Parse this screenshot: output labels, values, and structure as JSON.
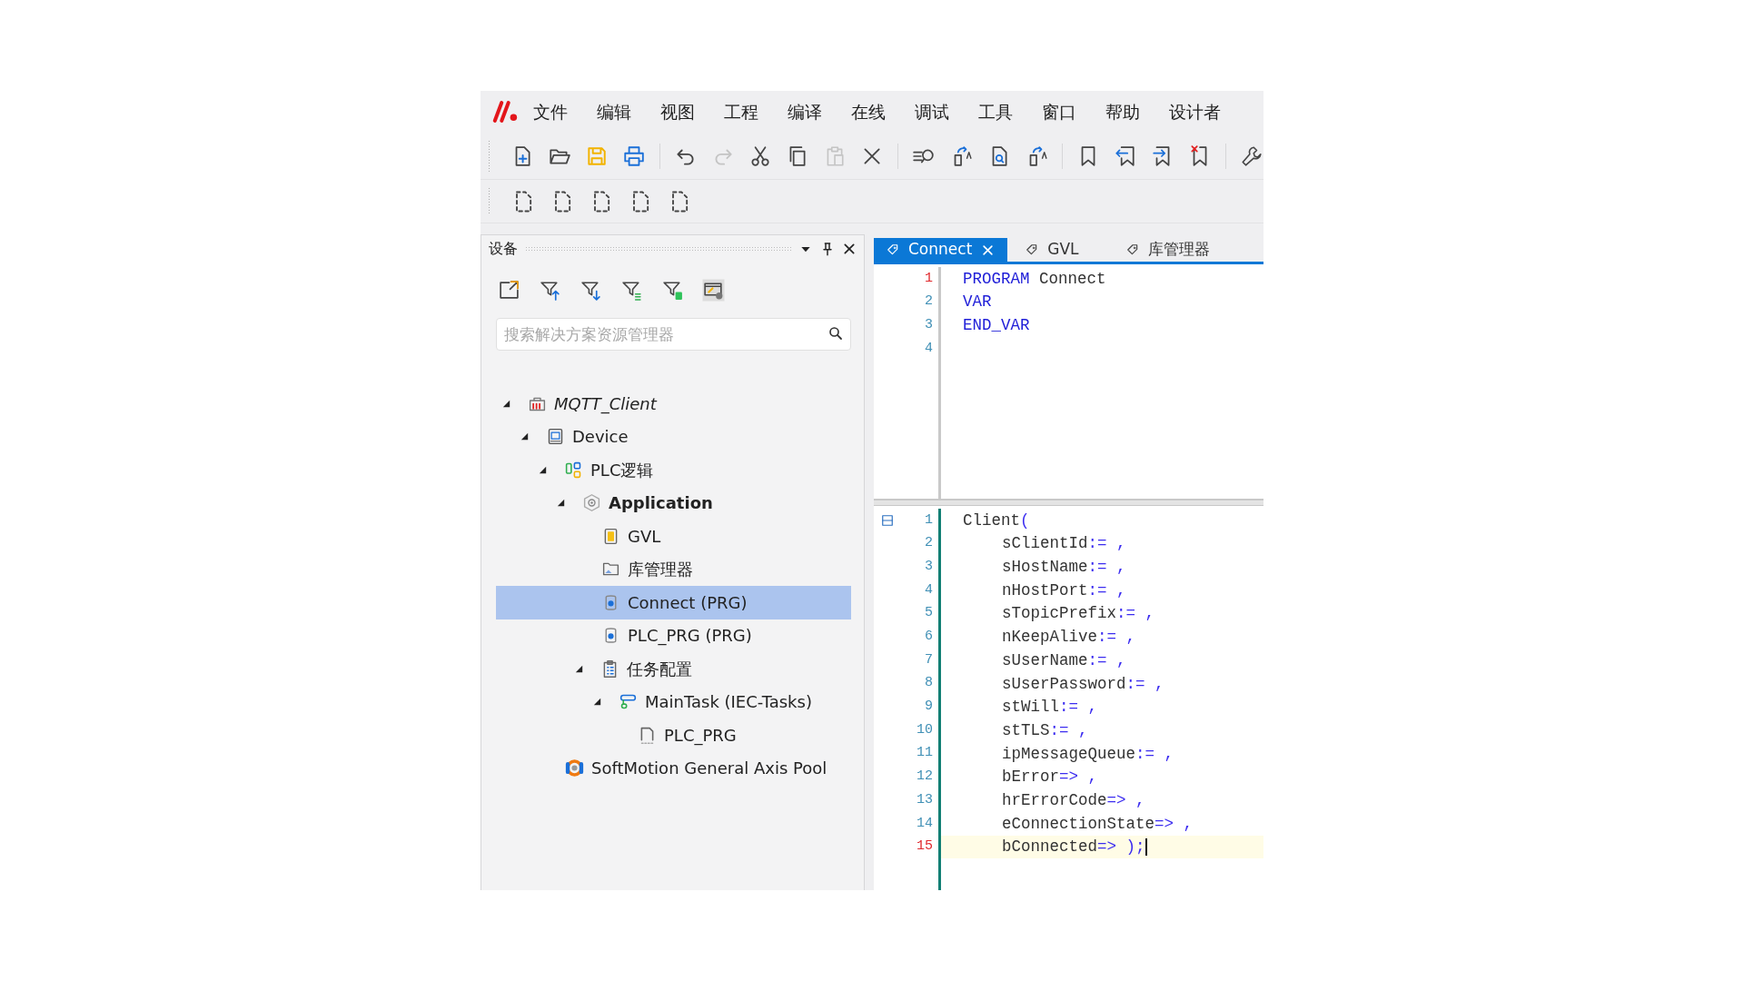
{
  "menu_bar": {
    "items": [
      "文件",
      "编辑",
      "视图",
      "工程",
      "编译",
      "在线",
      "调试",
      "工具",
      "窗口",
      "帮助",
      "设计者"
    ]
  },
  "toolbar_rows": [
    [
      {
        "kind": "new-file",
        "disabled": false
      },
      {
        "kind": "open-folder",
        "disabled": false
      },
      {
        "kind": "save",
        "disabled": false
      },
      {
        "kind": "print",
        "disabled": false
      },
      {
        "kind": "separator"
      },
      {
        "kind": "undo",
        "disabled": false
      },
      {
        "kind": "redo",
        "disabled": true
      },
      {
        "kind": "cut",
        "disabled": false
      },
      {
        "kind": "copy",
        "disabled": false
      },
      {
        "kind": "paste",
        "disabled": true
      },
      {
        "kind": "delete",
        "disabled": false
      },
      {
        "kind": "separator"
      },
      {
        "kind": "find",
        "disabled": false
      },
      {
        "kind": "page-arrow",
        "disabled": false
      },
      {
        "kind": "page-search",
        "disabled": false
      },
      {
        "kind": "page-arrow",
        "disabled": false
      },
      {
        "kind": "separator"
      },
      {
        "kind": "bookmark",
        "disabled": false
      },
      {
        "kind": "bookmark-prev",
        "disabled": false
      },
      {
        "kind": "bookmark-next",
        "disabled": false
      },
      {
        "kind": "bookmark-clear",
        "disabled": false
      },
      {
        "kind": "separator"
      },
      {
        "kind": "wrench",
        "disabled": false
      }
    ],
    [
      {
        "kind": "dashed-page",
        "disabled": false
      },
      {
        "kind": "dashed-page",
        "disabled": false
      },
      {
        "kind": "dashed-page",
        "disabled": false
      },
      {
        "kind": "dashed-page",
        "disabled": false
      },
      {
        "kind": "dashed-page",
        "disabled": false
      }
    ]
  ],
  "devices_panel": {
    "title": "设备",
    "toolbar": [
      {
        "kind": "export"
      },
      {
        "kind": "filter-up"
      },
      {
        "kind": "filter-down"
      },
      {
        "kind": "filter-lines"
      },
      {
        "kind": "filter-green"
      },
      {
        "kind": "window-settings"
      }
    ],
    "search": {
      "placeholder": "搜索解决方案资源管理器"
    },
    "tree": [
      {
        "label": "MQTT_Client",
        "kind": "project",
        "expanded": true,
        "selected": false,
        "children": [
          {
            "label": "Device",
            "kind": "device",
            "expanded": true,
            "selected": false,
            "children": [
              {
                "label": "PLC逻辑",
                "kind": "plc-logic",
                "expanded": true,
                "selected": false,
                "children": [
                  {
                    "label": "Application",
                    "kind": "application",
                    "expanded": true,
                    "selected": false,
                    "children": [
                      {
                        "label": "GVL",
                        "kind": "gvl",
                        "selected": false
                      },
                      {
                        "label": "库管理器",
                        "kind": "library",
                        "selected": false
                      },
                      {
                        "label": "Connect (PRG)",
                        "kind": "pou",
                        "selected": true
                      },
                      {
                        "label": "PLC_PRG (PRG)",
                        "kind": "pou",
                        "selected": false
                      },
                      {
                        "label": "任务配置",
                        "kind": "task-config",
                        "expanded": true,
                        "selected": false,
                        "children": [
                          {
                            "label": "MainTask (IEC-Tasks)",
                            "kind": "task",
                            "expanded": true,
                            "selected": false,
                            "children": [
                              {
                                "label": "PLC_PRG",
                                "kind": "task-call",
                                "selected": false
                              }
                            ]
                          }
                        ]
                      }
                    ]
                  }
                ]
              },
              {
                "label": "SoftMotion General Axis Pool",
                "kind": "axis-pool",
                "selected": false
              }
            ]
          }
        ]
      }
    ]
  },
  "editor": {
    "tabs": [
      {
        "label": "Connect",
        "selected": true
      },
      {
        "label": "GVL",
        "selected": false
      },
      {
        "label": "库管理器",
        "selected": false
      }
    ],
    "declaration": {
      "lines": [
        {
          "number": "1",
          "current": true,
          "tokens": [
            {
              "text": "PROGRAM",
              "kind": "keyword"
            },
            {
              "text": " Connect",
              "kind": "plain"
            }
          ]
        },
        {
          "number": "2",
          "current": false,
          "tokens": [
            {
              "text": "VAR",
              "kind": "keyword"
            }
          ]
        },
        {
          "number": "3",
          "current": false,
          "tokens": [
            {
              "text": "END_VAR",
              "kind": "keyword"
            }
          ]
        },
        {
          "number": "4",
          "current": false
        }
      ]
    },
    "implementation": {
      "lines": [
        {
          "number": "1",
          "current": false,
          "highlighted": false,
          "indented": false,
          "collapsible": true,
          "tokens": [
            {
              "text": "Client",
              "kind": "plain"
            },
            {
              "text": "(",
              "kind": "operator"
            }
          ]
        },
        {
          "number": "2",
          "current": false,
          "highlighted": false,
          "indented": true,
          "tokens": [
            {
              "text": "sClientId",
              "kind": "plain"
            },
            {
              "text": ":= ,",
              "kind": "operator"
            }
          ]
        },
        {
          "number": "3",
          "current": false,
          "highlighted": false,
          "indented": true,
          "tokens": [
            {
              "text": "sHostName",
              "kind": "plain"
            },
            {
              "text": ":= ,",
              "kind": "operator"
            }
          ]
        },
        {
          "number": "4",
          "current": false,
          "highlighted": false,
          "indented": true,
          "tokens": [
            {
              "text": "nHostPort",
              "kind": "plain"
            },
            {
              "text": ":= ,",
              "kind": "operator"
            }
          ]
        },
        {
          "number": "5",
          "current": false,
          "highlighted": false,
          "indented": true,
          "tokens": [
            {
              "text": "sTopicPrefix",
              "kind": "plain"
            },
            {
              "text": ":= ,",
              "kind": "operator"
            }
          ]
        },
        {
          "number": "6",
          "current": false,
          "highlighted": false,
          "indented": true,
          "tokens": [
            {
              "text": "nKeepAlive",
              "kind": "plain"
            },
            {
              "text": ":= ,",
              "kind": "operator"
            }
          ]
        },
        {
          "number": "7",
          "current": false,
          "highlighted": false,
          "indented": true,
          "tokens": [
            {
              "text": "sUserName",
              "kind": "plain"
            },
            {
              "text": ":= ,",
              "kind": "operator"
            }
          ]
        },
        {
          "number": "8",
          "current": false,
          "highlighted": false,
          "indented": true,
          "tokens": [
            {
              "text": "sUserPassword",
              "kind": "plain"
            },
            {
              "text": ":= ,",
              "kind": "operator"
            }
          ]
        },
        {
          "number": "9",
          "current": false,
          "highlighted": false,
          "indented": true,
          "tokens": [
            {
              "text": "stWill",
              "kind": "plain"
            },
            {
              "text": ":= ,",
              "kind": "operator"
            }
          ]
        },
        {
          "number": "10",
          "current": false,
          "highlighted": false,
          "indented": true,
          "tokens": [
            {
              "text": "stTLS",
              "kind": "plain"
            },
            {
              "text": ":= ,",
              "kind": "operator"
            }
          ]
        },
        {
          "number": "11",
          "current": false,
          "highlighted": false,
          "indented": true,
          "tokens": [
            {
              "text": "ipMessageQueue",
              "kind": "plain"
            },
            {
              "text": ":= ,",
              "kind": "operator"
            }
          ]
        },
        {
          "number": "12",
          "current": false,
          "highlighted": false,
          "indented": true,
          "tokens": [
            {
              "text": "bError",
              "kind": "plain"
            },
            {
              "text": "=> ,",
              "kind": "operator"
            }
          ]
        },
        {
          "number": "13",
          "current": false,
          "highlighted": false,
          "indented": true,
          "tokens": [
            {
              "text": "hrErrorCode",
              "kind": "plain"
            },
            {
              "text": "=> ,",
              "kind": "operator"
            }
          ]
        },
        {
          "number": "14",
          "current": false,
          "highlighted": false,
          "indented": true,
          "tokens": [
            {
              "text": "eConnectionState",
              "kind": "plain"
            },
            {
              "text": "=> ,",
              "kind": "operator"
            }
          ]
        },
        {
          "number": "15",
          "current": true,
          "highlighted": true,
          "indented": true,
          "tokens": [
            {
              "text": "bConnected",
              "kind": "plain"
            },
            {
              "text": "=> );",
              "kind": "operator"
            }
          ]
        }
      ]
    }
  }
}
